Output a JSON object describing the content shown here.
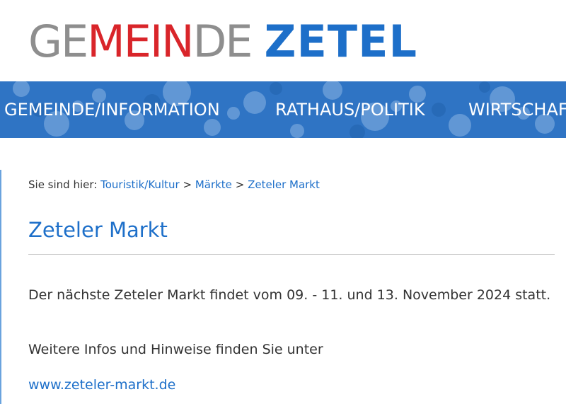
{
  "logo": {
    "part_ge": "GE",
    "part_mein": "MEIN",
    "part_de": "DE",
    "part_zetel": "ZETEL",
    "colors": {
      "gray": "#8e8e8e",
      "red": "#d9252a",
      "blue": "#1d6fc9"
    }
  },
  "nav": {
    "background": "#2f74c4",
    "items": [
      {
        "label": "GEMEINDE/INFORMATION"
      },
      {
        "label": "RATHAUS/POLITIK"
      },
      {
        "label": "WIRTSCHAFT"
      }
    ]
  },
  "breadcrumb": {
    "prefix": "Sie sind hier:",
    "links": [
      {
        "label": "Touristik/Kultur"
      },
      {
        "label": "Märkte"
      },
      {
        "label": "Zeteler Markt"
      }
    ],
    "separator": ">"
  },
  "main": {
    "title": "Zeteler Markt",
    "paragraph1": "Der nächste Zeteler Markt findet vom 09. - 11. und 13. November 2024 statt.",
    "paragraph2": "Weitere Infos und Hinweise finden Sie unter",
    "link": "www.zeteler-markt.de"
  }
}
